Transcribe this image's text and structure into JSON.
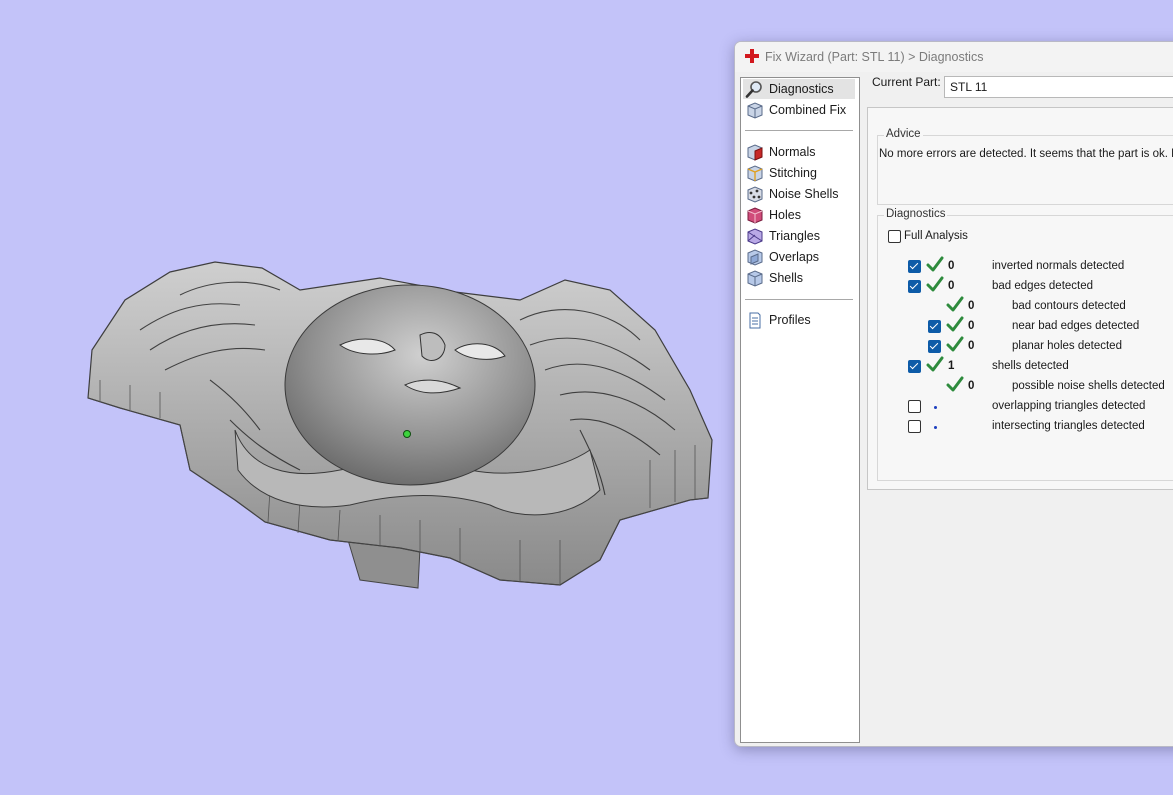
{
  "window": {
    "title": "Fix Wizard (Part: STL 11) > Diagnostics"
  },
  "nav": {
    "items": [
      {
        "label": "Diagnostics",
        "icon": "magnifier-icon",
        "selected": true
      },
      {
        "label": "Combined Fix",
        "icon": "cube-icon"
      },
      {
        "label": "Normals",
        "icon": "normals-cube-icon"
      },
      {
        "label": "Stitching",
        "icon": "stitching-cube-icon"
      },
      {
        "label": "Noise Shells",
        "icon": "noise-shells-icon"
      },
      {
        "label": "Holes",
        "icon": "holes-cube-icon"
      },
      {
        "label": "Triangles",
        "icon": "triangles-cube-icon"
      },
      {
        "label": "Overlaps",
        "icon": "overlaps-cube-icon"
      },
      {
        "label": "Shells",
        "icon": "shells-cube-icon"
      },
      {
        "label": "Profiles",
        "icon": "document-icon"
      }
    ]
  },
  "current_part": {
    "label": "Current Part:",
    "value": "STL 11"
  },
  "advice": {
    "title": "Advice",
    "text": "No more errors are detected. It seems that the part is ok. N"
  },
  "diagnostics": {
    "title": "Diagnostics",
    "full_analysis_label": "Full Analysis",
    "full_analysis_checked": false,
    "rows": [
      {
        "checked": true,
        "status": "ok",
        "count": "0",
        "text": "inverted normals detected"
      },
      {
        "checked": true,
        "status": "ok",
        "count": "0",
        "text": "bad edges detected"
      },
      {
        "checked": null,
        "status": "ok",
        "count": "0",
        "text": "bad contours detected"
      },
      {
        "checked": true,
        "status": "ok",
        "count": "0",
        "text": "near bad edges detected"
      },
      {
        "checked": true,
        "status": "ok",
        "count": "0",
        "text": "planar holes detected"
      },
      {
        "checked": true,
        "status": "ok",
        "count": "1",
        "text": "shells detected"
      },
      {
        "checked": null,
        "status": "ok",
        "count": "0",
        "text": "possible noise shells detected"
      },
      {
        "checked": false,
        "status": "pending",
        "count": "",
        "text": "overlapping triangles detected"
      },
      {
        "checked": false,
        "status": "pending",
        "count": "",
        "text": "intersecting triangles detected"
      }
    ]
  },
  "colors": {
    "viewport_background": "#c3c3f9",
    "model_gray": "#a9a9a9",
    "ok_green": "#2e8b3d",
    "checkbox_blue": "#0d5ba8",
    "app_red": "#d2181e"
  }
}
